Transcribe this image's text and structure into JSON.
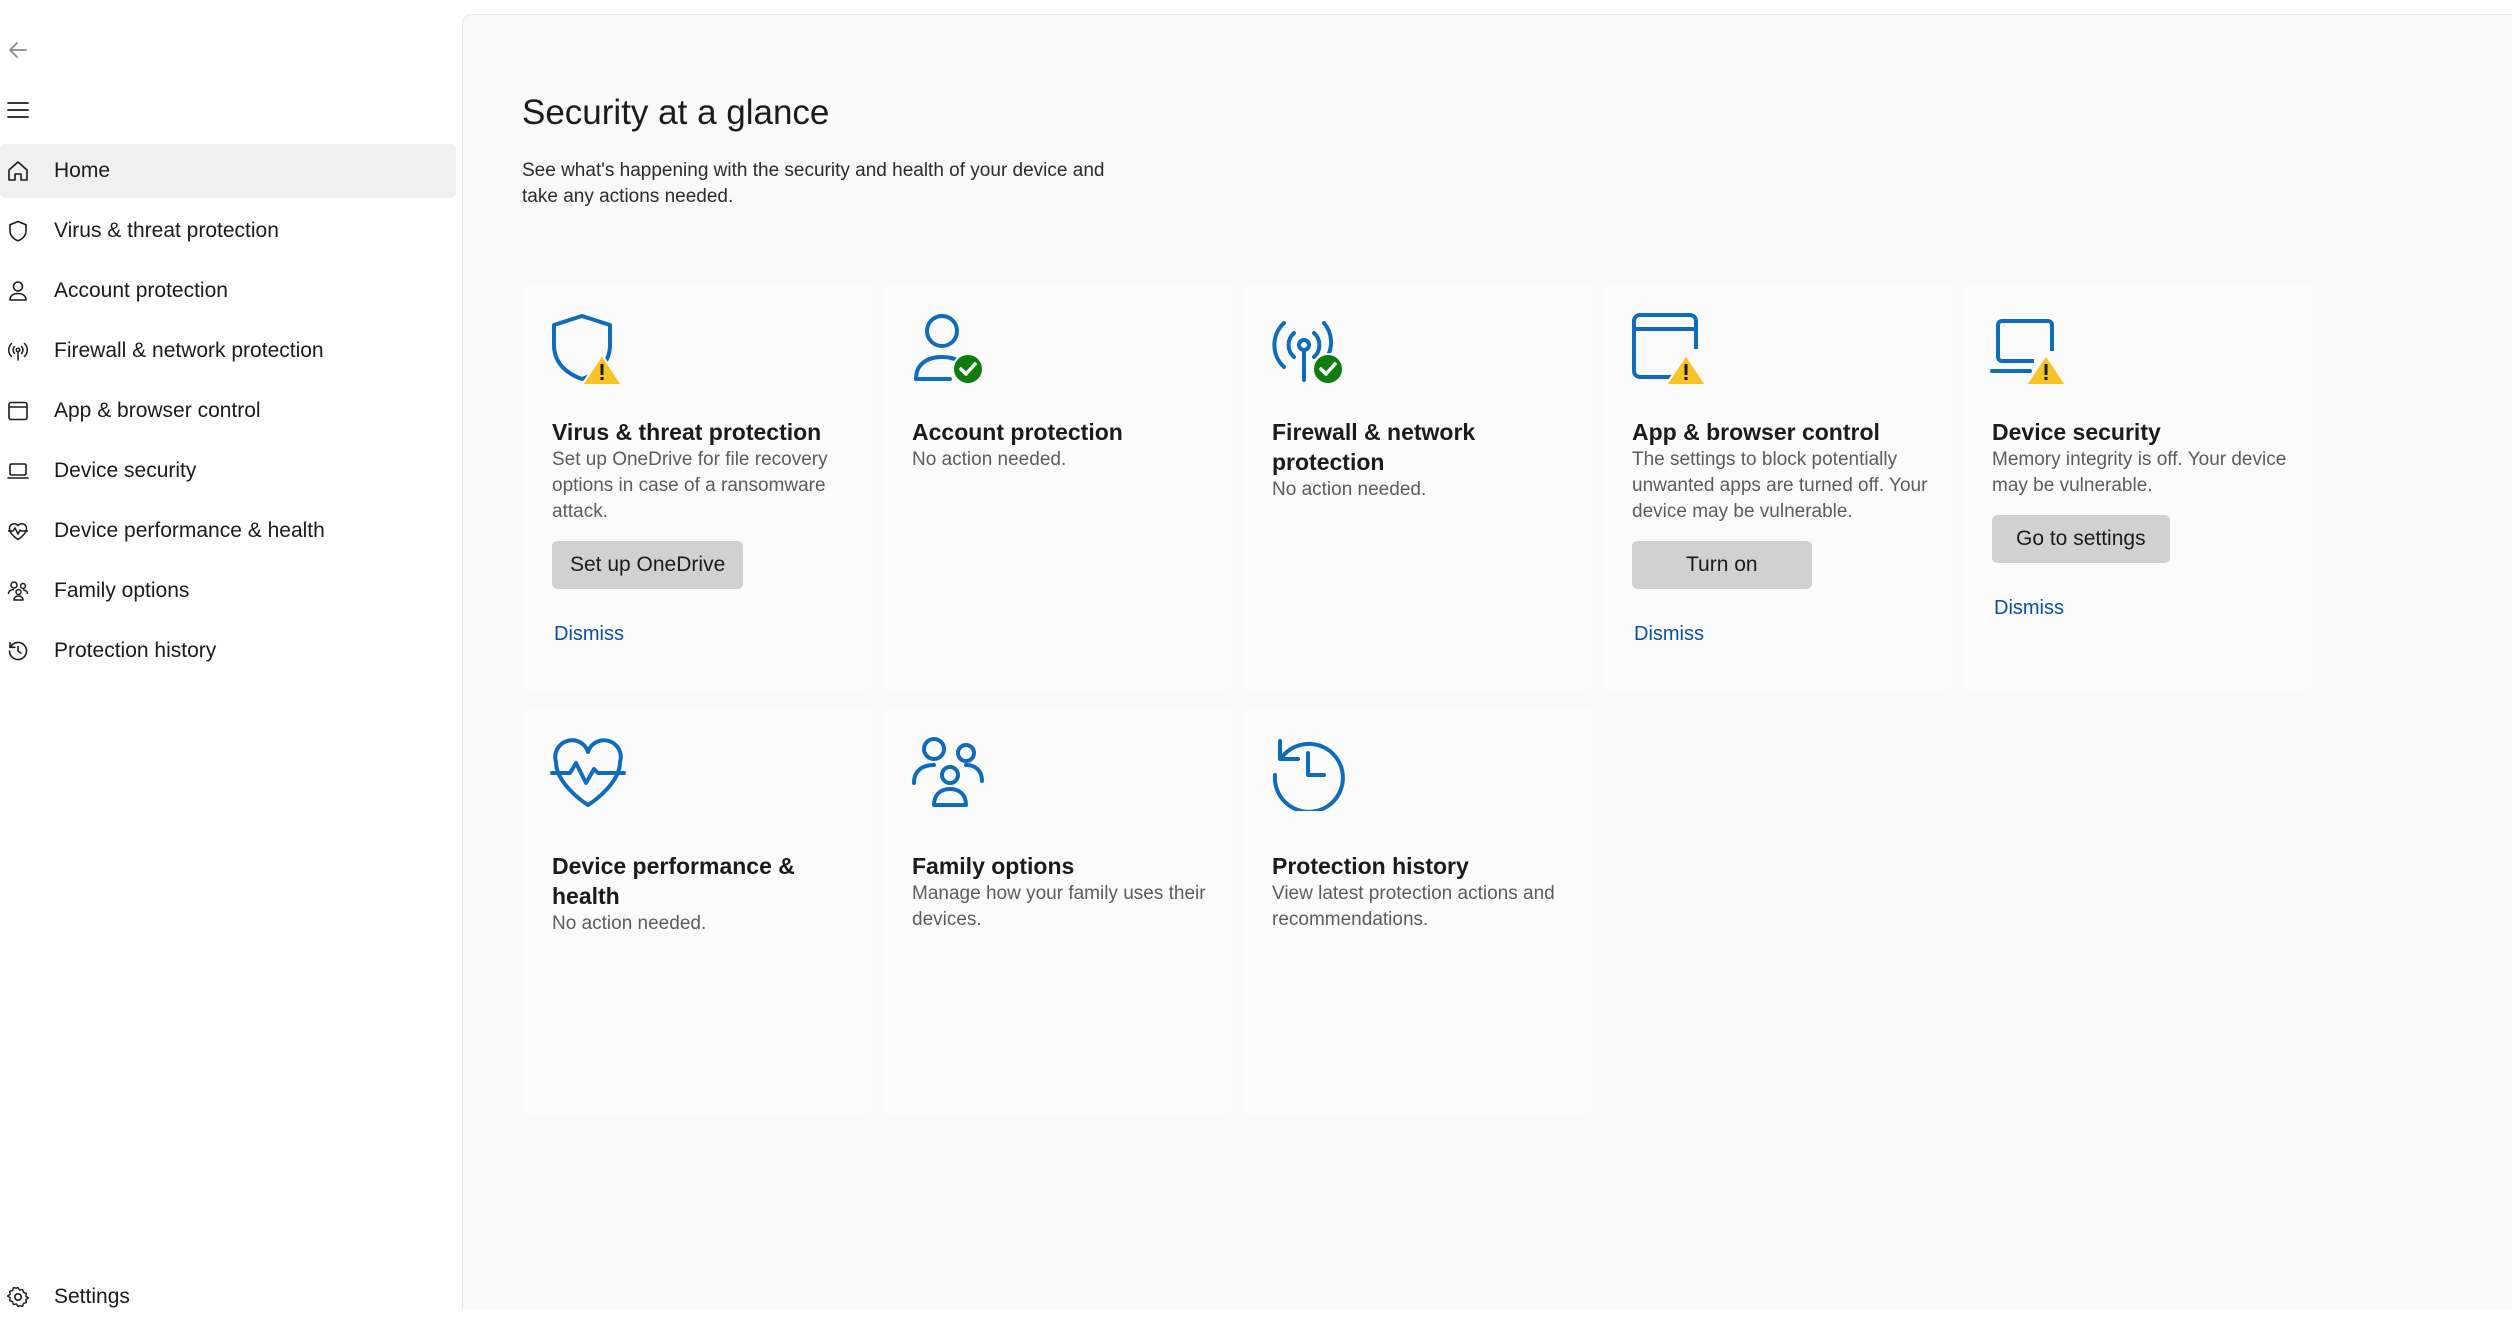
{
  "colors": {
    "accent_blue": "#0f6cbd",
    "link_blue": "#0a4fa3",
    "warning_yellow": "#f7c325",
    "ok_green": "#107c10",
    "button_gray": "#d1d1d1"
  },
  "sidebar": {
    "back_icon": "back-arrow-icon",
    "menu_icon": "hamburger-menu-icon",
    "items": [
      {
        "label": "Home",
        "icon": "home-icon",
        "selected": true
      },
      {
        "label": "Virus & threat protection",
        "icon": "shield-icon"
      },
      {
        "label": "Account protection",
        "icon": "person-icon"
      },
      {
        "label": "Firewall & network protection",
        "icon": "antenna-icon"
      },
      {
        "label": "App & browser control",
        "icon": "browser-window-icon"
      },
      {
        "label": "Device security",
        "icon": "laptop-icon"
      },
      {
        "label": "Device performance & health",
        "icon": "heart-pulse-icon"
      },
      {
        "label": "Family options",
        "icon": "family-icon"
      },
      {
        "label": "Protection history",
        "icon": "history-icon"
      }
    ],
    "settings_label": "Settings"
  },
  "main": {
    "title": "Security at a glance",
    "subtitle": "See what's happening with the security and health of your device and take any actions needed.",
    "cards": [
      {
        "title": "Virus & threat protection",
        "description": "Set up OneDrive for file recovery options in case of a ransomware attack.",
        "button": "Set up OneDrive",
        "link": "Dismiss",
        "icon": "shield-warning-icon",
        "status": "warning"
      },
      {
        "title": "Account protection",
        "description": "No action needed.",
        "icon": "person-ok-icon",
        "status": "ok"
      },
      {
        "title": "Firewall & network protection",
        "description": "No action needed.",
        "icon": "antenna-ok-icon",
        "status": "ok"
      },
      {
        "title": "App & browser control",
        "description": "The settings to block potentially unwanted apps are turned off. Your device may be vulnerable.",
        "button": "Turn on",
        "link": "Dismiss",
        "icon": "browser-warning-icon",
        "status": "warning"
      },
      {
        "title": "Device security",
        "description": "Memory integrity is off. Your device may be vulnerable.",
        "button": "Go to settings",
        "link": "Dismiss",
        "icon": "laptop-warning-icon",
        "status": "warning"
      },
      {
        "title": "Device performance & health",
        "description": "No action needed.",
        "icon": "heart-pulse-icon"
      },
      {
        "title": "Family options",
        "description": "Manage how your family uses their devices.",
        "icon": "family-icon"
      },
      {
        "title": "Protection history",
        "description": "View latest protection actions and recommendations.",
        "icon": "history-icon"
      }
    ]
  }
}
